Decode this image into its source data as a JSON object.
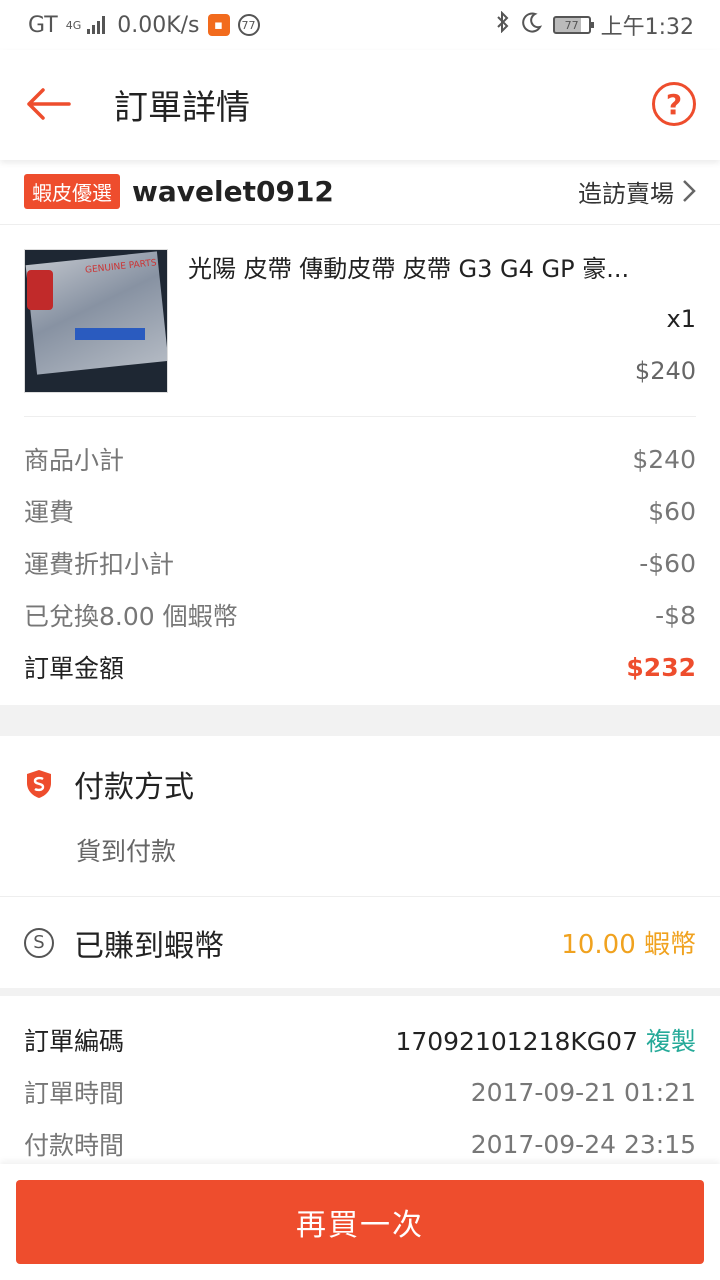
{
  "status_bar": {
    "carrier": "GT",
    "network_tag": "4G",
    "speed": "0.00K/s",
    "notif_count": "77",
    "battery": "77",
    "time": "上午1:32"
  },
  "header": {
    "title": "訂單詳情",
    "help_glyph": "?"
  },
  "shop": {
    "badge": "蝦皮優選",
    "name": "wavelet0912",
    "visit_label": "造訪賣場"
  },
  "product": {
    "name": "光陽 皮帶 傳動皮帶 皮帶 G3 G4 GP 豪...",
    "quantity": "x1",
    "price": "$240",
    "thumb_text": "GENUINE PARTS"
  },
  "totals": [
    {
      "label": "商品小計",
      "value": "$240"
    },
    {
      "label": "運費",
      "value": "$60"
    },
    {
      "label": "運費折扣小計",
      "value": "-$60"
    },
    {
      "label": "已兌換8.00 個蝦幣",
      "value": "-$8"
    }
  ],
  "order_total": {
    "label": "訂單金額",
    "value": "$232"
  },
  "payment": {
    "title": "付款方式",
    "method": "貨到付款"
  },
  "coins": {
    "icon_glyph": "S",
    "title": "已賺到蝦幣",
    "value": "10.00 蝦幣"
  },
  "order_info": {
    "number_label": "訂單編碼",
    "number": "17092101218KG07",
    "copy_label": "複製",
    "order_time_label": "訂單時間",
    "order_time": "2017-09-21 01:21",
    "pay_time_label": "付款時間",
    "pay_time": "2017-09-24 23:15"
  },
  "actions": {
    "buy_again": "再買一次"
  },
  "colors": {
    "accent": "#ee4d2d",
    "coin": "#f0a21f",
    "copy": "#26aa99"
  }
}
